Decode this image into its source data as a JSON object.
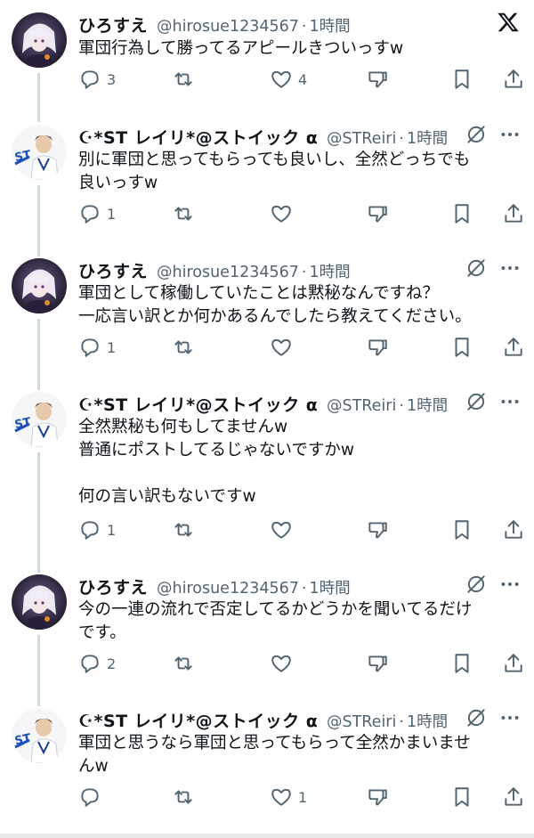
{
  "app": {
    "logo": "x-logo-icon"
  },
  "tweets": [
    {
      "author": "ひろすえ",
      "handle": "@hirosue1234567",
      "time": "1時間",
      "text": "軍団行為して勝ってるアピールきついっすw",
      "stats": {
        "reply": "3",
        "retweet": "",
        "like": "4"
      },
      "avatar": "anime-avatar"
    },
    {
      "author": "☪*ST レイリ*@ストイック α",
      "handle": "@STReiri",
      "time": "1時間",
      "text": "別に軍団と思ってもらっても良いし、全然どっちでも\n良いっすw",
      "stats": {
        "reply": "1",
        "retweet": "",
        "like": ""
      },
      "avatar": "person-avatar"
    },
    {
      "author": "ひろすえ",
      "handle": "@hirosue1234567",
      "time": "1時間",
      "text": "軍団として稼働していたことは黙秘なんですね？\n一応言い訳とか何かあるんでしたら教えてください。",
      "stats": {
        "reply": "1",
        "retweet": "",
        "like": ""
      },
      "avatar": "anime-avatar"
    },
    {
      "author": "☪*ST レイリ*@ストイック α",
      "handle": "@STReiri",
      "time": "1時間",
      "text": "全然黙秘も何もしてませんw\n普通にポストしてるじゃないですかw\n\n何の言い訳もないですw",
      "stats": {
        "reply": "1",
        "retweet": "",
        "like": ""
      },
      "avatar": "person-avatar"
    },
    {
      "author": "ひろすえ",
      "handle": "@hirosue1234567",
      "time": "1時間",
      "text": "今の一連の流れで否定してるかどうかを聞いてるだけ\nです。",
      "stats": {
        "reply": "2",
        "retweet": "",
        "like": ""
      },
      "avatar": "anime-avatar"
    },
    {
      "author": "☪*ST レイリ*@ストイック α",
      "handle": "@STReiri",
      "time": "1時間",
      "text": "軍団と思うなら軍団と思ってもらって全然かまいませ\nんw",
      "stats": {
        "reply": "",
        "retweet": "",
        "like": "1"
      },
      "avatar": "person-avatar"
    }
  ]
}
